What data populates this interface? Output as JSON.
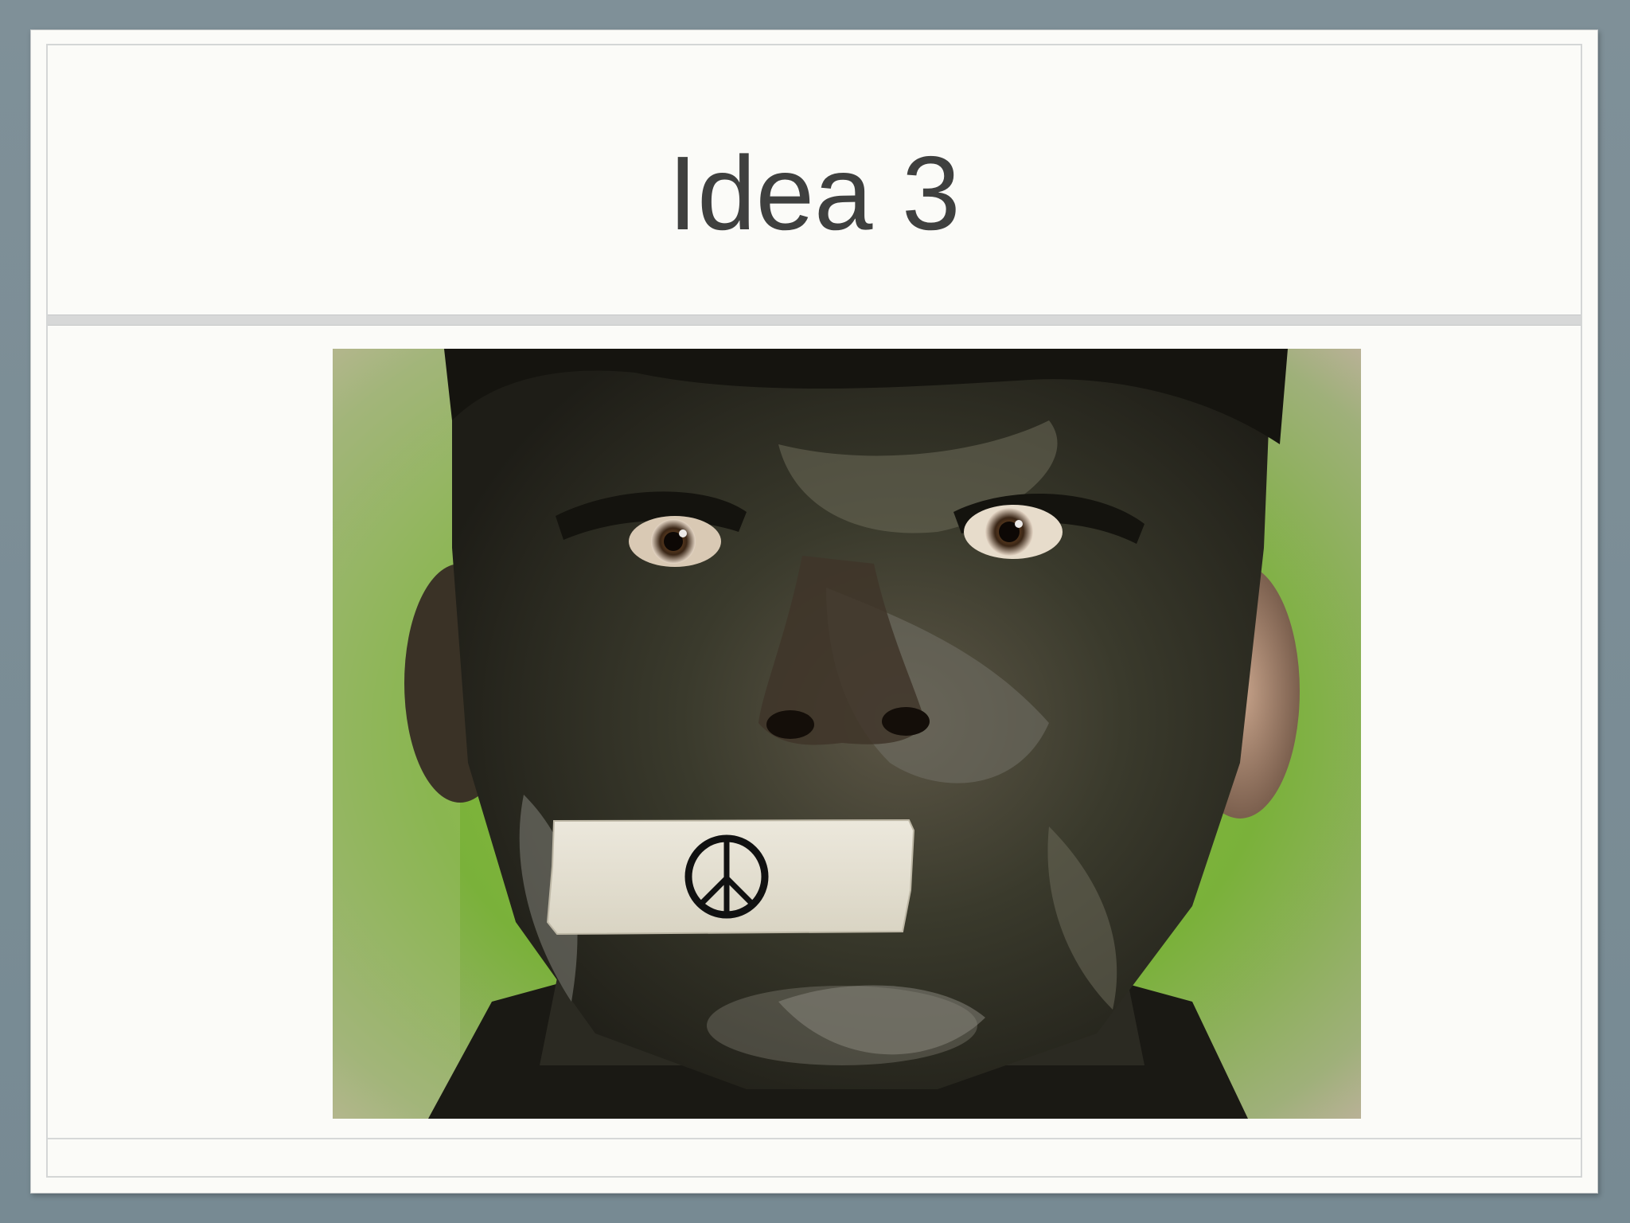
{
  "slide": {
    "title": "Idea 3"
  },
  "image": {
    "subject": "face-painted-with-camouflage-peace-tape-photo",
    "tape_icon": "peace-symbol-icon"
  },
  "colors": {
    "background": "#7f9098",
    "slide": "#fbfbf8",
    "title_text": "#3f403f",
    "rule": "#d7d8d8"
  }
}
